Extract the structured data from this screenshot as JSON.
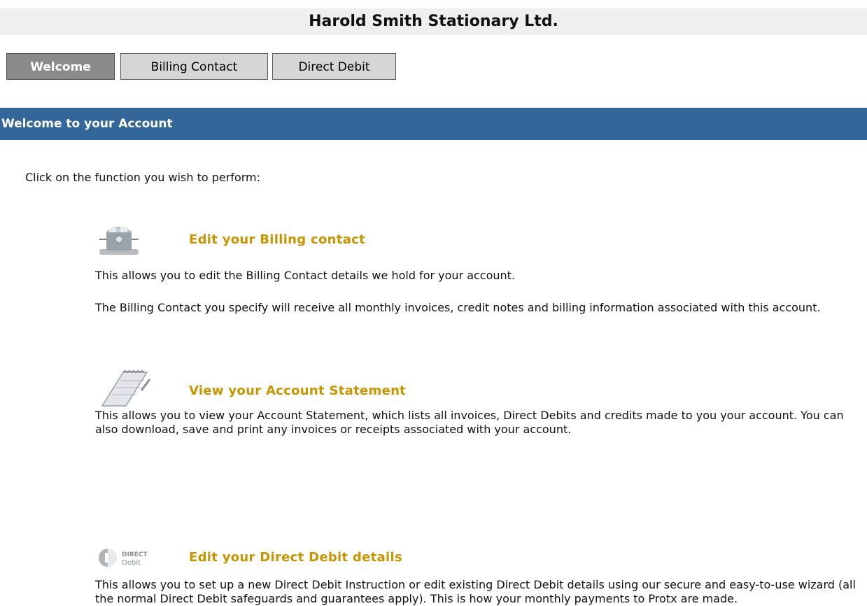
{
  "header": {
    "company_name": "Harold Smith Stationary Ltd."
  },
  "tabs": [
    {
      "label": "Welcome",
      "active": true
    },
    {
      "label": "Billing Contact",
      "active": false
    },
    {
      "label": "Direct Debit",
      "active": false
    }
  ],
  "section": {
    "title": "Welcome to your Account"
  },
  "intro": "Click on the function you wish to perform:",
  "items": [
    {
      "icon": "rolodex-icon",
      "title": "Edit your Billing contact",
      "desc": [
        "This allows you to edit the Billing Contact details we hold for your account.",
        "The Billing Contact you specify will receive all monthly invoices, credit notes and billing information associated with this account."
      ]
    },
    {
      "icon": "notepad-icon",
      "title": "View your Account Statement",
      "desc": [
        "This allows you to view your Account Statement, which lists all invoices, Direct Debits and credits made to you your account. You can also download, save and print any invoices or receipts associated with your account."
      ]
    },
    {
      "icon": "direct-debit-logo",
      "logo_text": [
        "DIRECT",
        "Debit"
      ],
      "title": "Edit your Direct Debit details",
      "desc": [
        "This allows you to set up a new Direct Debit Instruction or edit existing Direct Debit details using our secure and easy-to-use wizard (all the normal Direct Debit safeguards and guarantees apply). This is how your monthly payments to Protx are made."
      ]
    }
  ],
  "colors": {
    "section_bar": "#336699",
    "link_title": "#c89400",
    "active_tab": "#8a8a8a",
    "inactive_tab": "#d6d6d6"
  }
}
